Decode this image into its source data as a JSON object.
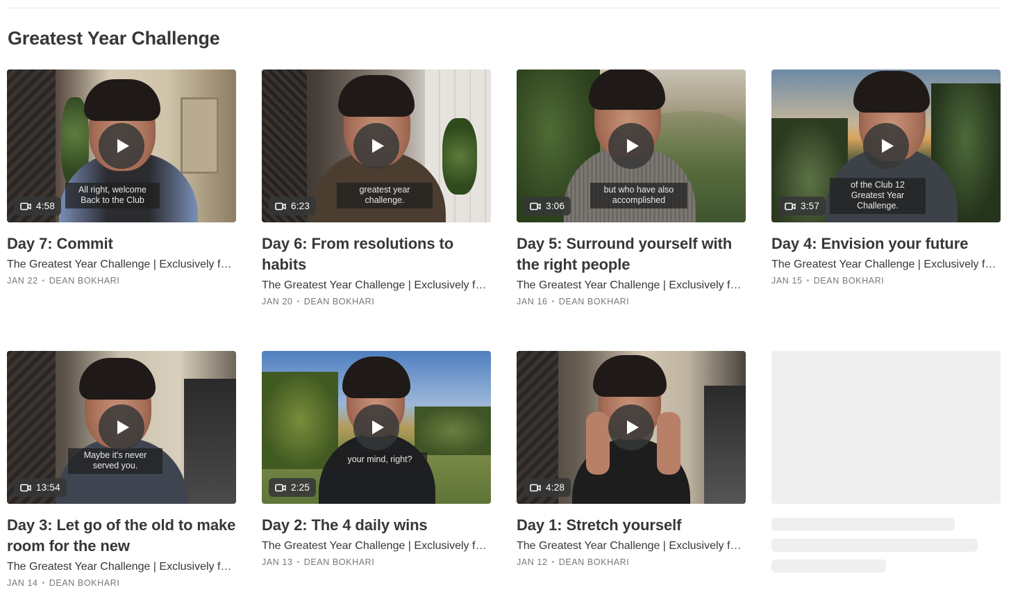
{
  "section": {
    "title": "Greatest Year Challenge"
  },
  "colors": {
    "text": "#363737",
    "meta": "#777777",
    "skeleton": "#efefef",
    "overlay": "#363737"
  },
  "icons": {
    "play": "play-icon",
    "video": "video-camera-icon"
  },
  "posts": [
    {
      "title": "Day 7: Commit",
      "subtitle": "The Greatest Year Challenge | Exclusively for paid subscribers",
      "date": "JAN 22",
      "author": "DEAN BOKHARI",
      "duration": "4:58",
      "caption": "All right, welcome\nBack to the Club"
    },
    {
      "title": "Day 6: From resolutions to habits",
      "subtitle": "The Greatest Year Challenge | Exclusively for paid subscribers",
      "date": "JAN 20",
      "author": "DEAN BOKHARI",
      "duration": "6:23",
      "caption": "greatest year\nchallenge."
    },
    {
      "title": "Day 5: Surround yourself with the right people",
      "subtitle": "The Greatest Year Challenge | Exclusively for paid subscribers",
      "date": "JAN 16",
      "author": "DEAN BOKHARI",
      "duration": "3:06",
      "caption": "but who have also\naccomplished"
    },
    {
      "title": "Day 4: Envision your future",
      "subtitle": "The Greatest Year Challenge | Exclusively for paid subscribers",
      "date": "JAN 15",
      "author": "DEAN BOKHARI",
      "duration": "3:57",
      "caption": "of the Club 12\nGreatest Year\nChallenge."
    },
    {
      "title": "Day 3: Let go of the old to make room for the new",
      "subtitle": "The Greatest Year Challenge | Exclusively for paid subscribers",
      "date": "JAN 14",
      "author": "DEAN BOKHARI",
      "duration": "13:54",
      "caption": "Maybe it's never\nserved you."
    },
    {
      "title": "Day 2: The 4 daily wins",
      "subtitle": "The Greatest Year Challenge | Exclusively for paid subscribers",
      "date": "JAN 13",
      "author": "DEAN BOKHARI",
      "duration": "2:25",
      "caption": "your mind, right?"
    },
    {
      "title": "Day 1: Stretch yourself",
      "subtitle": "The Greatest Year Challenge | Exclusively for paid subscribers",
      "date": "JAN 12",
      "author": "DEAN BOKHARI",
      "duration": "4:28",
      "caption": ""
    }
  ]
}
